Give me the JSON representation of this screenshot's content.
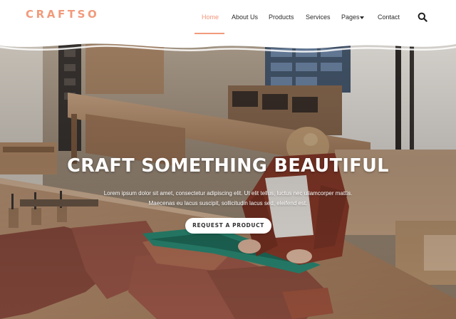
{
  "brand": {
    "logo_text": "CRAFTSO",
    "accent_color": "#f19b7c"
  },
  "nav": {
    "items": [
      {
        "label": "Home",
        "active": true
      },
      {
        "label": "About Us",
        "active": false
      },
      {
        "label": "Products",
        "active": false
      },
      {
        "label": "Services",
        "active": false
      },
      {
        "label": "Pages",
        "active": false,
        "has_dropdown": true
      },
      {
        "label": "Contact",
        "active": false
      }
    ],
    "search_icon": "search-icon"
  },
  "hero": {
    "title": "CRAFT SOMETHING BEAUTIFUL",
    "text_line_1": "Lorem ipsum dolor sit amet, consectetur adipiscing elit. Ut elit tellus, luctus nec ullamcorper mattis.",
    "text_line_2": "Maecenas eu lacus suscipit, sollicitudin lacus sed, eleifend est.",
    "cta_label": "REQUEST A PRODUCT",
    "background": "photo of a craftswoman cutting leather at a workshop bench"
  }
}
